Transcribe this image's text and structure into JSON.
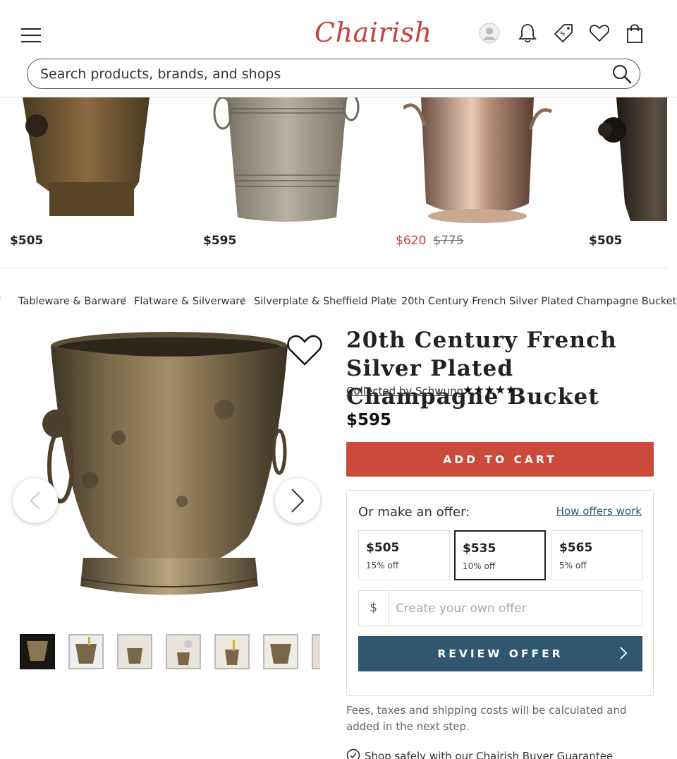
{
  "header": {
    "logo_text": "Chairish",
    "search_placeholder": "Search products, brands, and shops",
    "icons": [
      "menu-icon",
      "account-icon",
      "bell-icon",
      "price-tag-icon",
      "heart-icon",
      "shopping-bag-icon",
      "search-icon"
    ]
  },
  "recommendations": [
    {
      "price": "$505"
    },
    {
      "price": "$595"
    },
    {
      "price": "$620",
      "original_price": "$775"
    },
    {
      "price": "$505"
    }
  ],
  "breadcrumbs": [
    "Tableware & Barware",
    "Flatware & Silverware",
    "Silverplate & Sheffield Plate",
    "20th Century French Silver Plated Champagne Bucket"
  ],
  "product": {
    "title": "20th Century French Silver Plated Champagne Bucket",
    "seller": "Collected by Schwung",
    "rating_stars": "★★★★★",
    "price": "$595",
    "add_to_cart_label": "ADD TO CART"
  },
  "offer": {
    "label": "Or make an offer:",
    "how_link": "How offers work",
    "options": [
      {
        "amount": "$505",
        "discount": "15% off"
      },
      {
        "amount": "$535",
        "discount": "10% off",
        "selected": true
      },
      {
        "amount": "$565",
        "discount": "5% off"
      }
    ],
    "currency_symbol": "$",
    "own_offer_placeholder": "Create your own offer",
    "review_label": "REVIEW OFFER"
  },
  "fees_text": "Fees, taxes and shipping costs will be calculated and added in the next step.",
  "guarantee_text": "Shop safely with our Chairish Buyer Guarantee",
  "colors": {
    "brand": "#c8423a",
    "add_to_cart": "#cc4a3c",
    "review": "#2f5770",
    "link": "#2a5a73"
  }
}
